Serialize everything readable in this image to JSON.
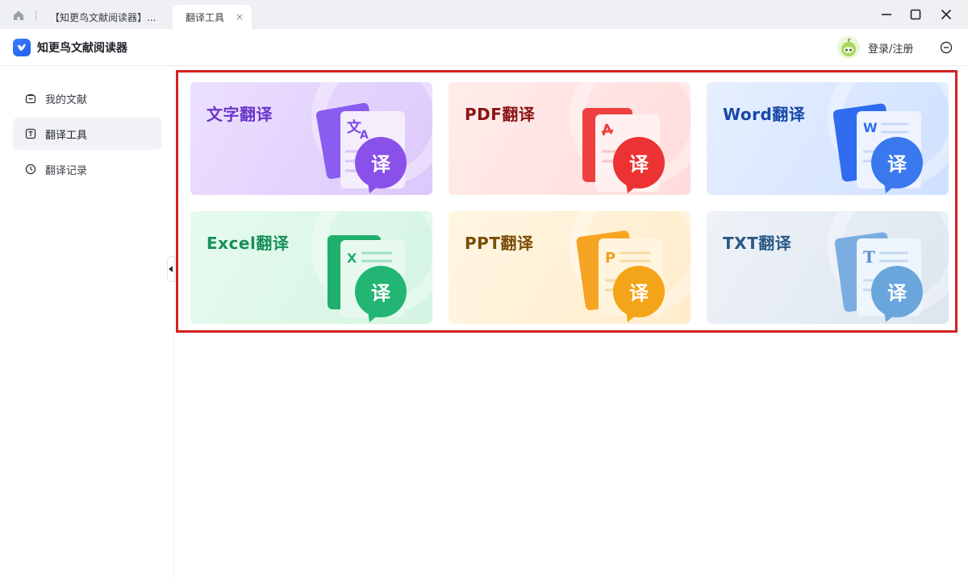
{
  "tabs": [
    {
      "label": "【知更鸟文献阅读器】..."
    },
    {
      "label": "翻译工具",
      "close": "×"
    }
  ],
  "header": {
    "app_title": "知更鸟文献阅读器",
    "login": "登录/注册"
  },
  "sidebar": {
    "items": [
      {
        "label": "我的文献",
        "icon": "bag-icon"
      },
      {
        "label": "翻译工具",
        "icon": "translate-box-icon",
        "active": true
      },
      {
        "label": "翻译记录",
        "icon": "clock-icon"
      }
    ]
  },
  "cards": [
    {
      "label": "文字翻译",
      "badge": "译",
      "color": "#6a35c8"
    },
    {
      "label": "PDF翻译",
      "badge": "译",
      "color": "#8a1414"
    },
    {
      "label": "Word翻译",
      "badge": "译",
      "color": "#1848a8"
    },
    {
      "label": "Excel翻译",
      "badge": "译",
      "color": "#17905a"
    },
    {
      "label": "PPT翻译",
      "badge": "译",
      "color": "#7a4d07"
    },
    {
      "label": "TXT翻译",
      "badge": "译",
      "color": "#2b5a85"
    }
  ],
  "colors": {
    "highlight_border": "#d42121",
    "accent_blue": "#2a6cff"
  }
}
